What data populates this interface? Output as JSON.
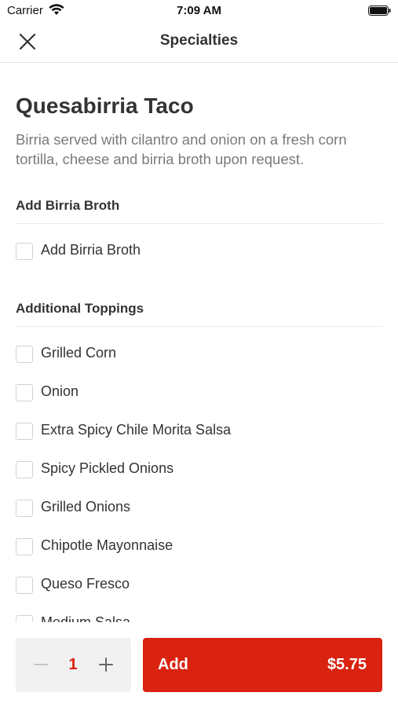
{
  "status_bar": {
    "carrier": "Carrier",
    "time": "7:09 AM"
  },
  "nav": {
    "title": "Specialties",
    "close_icon": "close-icon"
  },
  "item": {
    "title": "Quesabirria Taco",
    "description": "Birria served with cilantro and onion on a fresh corn tortilla, cheese and birria broth upon request."
  },
  "sections": [
    {
      "header": "Add Birria Broth",
      "options": [
        {
          "label": "Add Birria Broth",
          "checked": false
        }
      ]
    },
    {
      "header": "Additional Toppings",
      "options": [
        {
          "label": "Grilled Corn",
          "checked": false
        },
        {
          "label": "Onion",
          "checked": false
        },
        {
          "label": "Extra Spicy Chile Morita Salsa",
          "checked": false
        },
        {
          "label": "Spicy Pickled Onions",
          "checked": false
        },
        {
          "label": "Grilled Onions",
          "checked": false
        },
        {
          "label": "Chipotle Mayonnaise",
          "checked": false
        },
        {
          "label": "Queso Fresco",
          "checked": false
        },
        {
          "label": "Medium Salsa",
          "checked": false
        }
      ]
    }
  ],
  "footer": {
    "quantity": "1",
    "minus_icon": "minus-icon",
    "plus_icon": "plus-icon",
    "add_label": "Add",
    "price": "$5.75"
  },
  "colors": {
    "accent": "#d9220f",
    "text": "#333333",
    "muted_text": "#7a7a7a"
  }
}
